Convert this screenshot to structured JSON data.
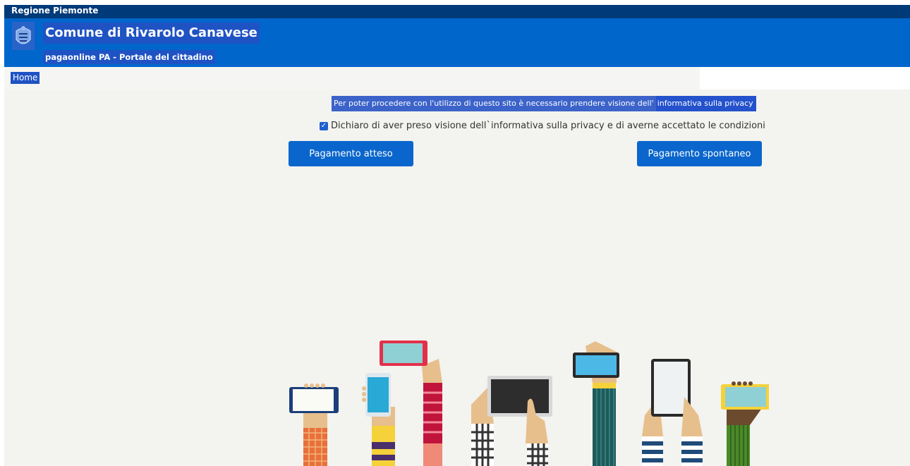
{
  "header": {
    "region": "Regione Piemonte",
    "municipality": "Comune di Rivarolo Canavese",
    "portal": "pagaonline PA - Portale del cittadino",
    "crest_icon": "crest-icon"
  },
  "nav": {
    "home": "Home"
  },
  "privacy": {
    "notice_text": "Per poter procedere con l'utilizzo di questo sito è necessario prendere visione dell'",
    "notice_link": "informativa sulla privacy",
    "consent_label": "Dichiaro di aver preso visione dell`informativa sulla privacy e di averne accettato le condizioni",
    "consent_checked": true
  },
  "buttons": {
    "expected_payment": "Pagamento atteso",
    "spontaneous_payment": "Pagamento spontaneo"
  },
  "colors": {
    "region_bar": "#003a78",
    "header": "#0066cc",
    "button": "#0a66cc",
    "background": "#f3f3ef"
  }
}
